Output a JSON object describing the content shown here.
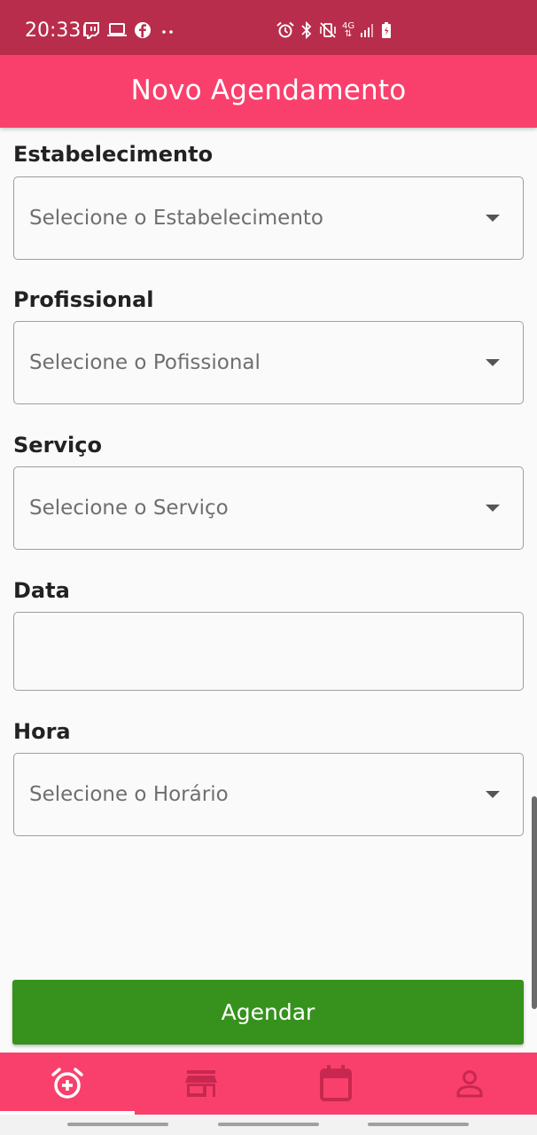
{
  "status_bar": {
    "time": "20:33",
    "left_icons": [
      "twitch-icon",
      "laptop-icon",
      "facebook-icon",
      "more-dots-icon"
    ],
    "right_icons": [
      "alarm-icon",
      "bluetooth-icon",
      "vibrate-mute-icon",
      "4g-icon",
      "signal-icon",
      "battery-charging-icon"
    ],
    "network_label": "4G"
  },
  "app_bar": {
    "title": "Novo Agendamento"
  },
  "form": {
    "establishment": {
      "label": "Estabelecimento",
      "placeholder": "Selecione o Estabelecimento"
    },
    "professional": {
      "label": "Profissional",
      "placeholder": "Selecione o Pofissional"
    },
    "service": {
      "label": "Serviço",
      "placeholder": "Selecione o Serviço"
    },
    "date": {
      "label": "Data",
      "value": ""
    },
    "time": {
      "label": "Hora",
      "placeholder": "Selecione o Horário"
    },
    "submit_label": "Agendar"
  },
  "bottom_nav": {
    "items": [
      {
        "icon": "alarm-add-icon",
        "active": true
      },
      {
        "icon": "store-icon",
        "active": false
      },
      {
        "icon": "calendar-icon",
        "active": false
      },
      {
        "icon": "person-icon",
        "active": false
      }
    ]
  },
  "colors": {
    "status_bar": "#b82d4b",
    "primary": "#f9406c",
    "submit_button": "#36921d",
    "inactive_nav_icon": "#c8284f",
    "active_nav_icon": "#ffffff"
  }
}
